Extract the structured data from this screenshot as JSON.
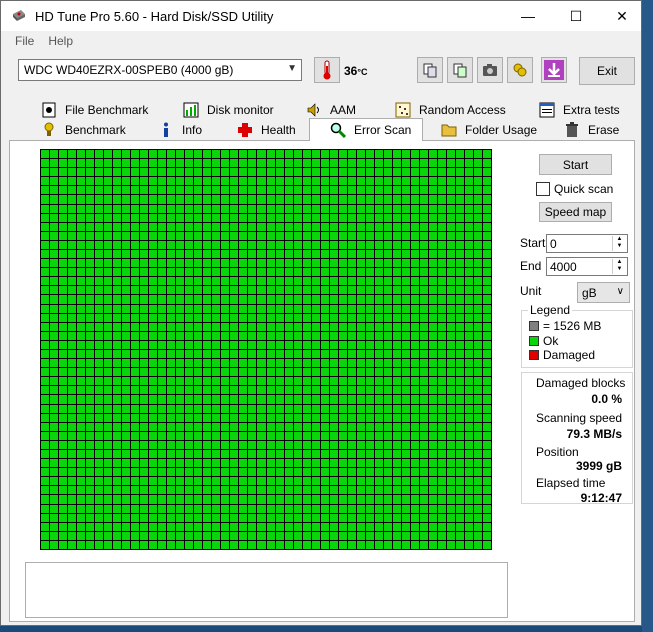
{
  "window": {
    "title": "HD Tune Pro 5.60 - Hard Disk/SSD Utility",
    "controls": {
      "minimize": "—",
      "maximize": "☐",
      "close": "✕"
    }
  },
  "menu": {
    "file": "File",
    "help": "Help"
  },
  "toolbar": {
    "drive": "WDC WD40EZRX-00SPEB0 (4000 gB)",
    "temperature": "36",
    "temperature_unit": "°C",
    "exit_label": "Exit"
  },
  "tabs_top": [
    {
      "label": "File Benchmark",
      "icon": "file-benchmark-icon"
    },
    {
      "label": "Disk monitor",
      "icon": "disk-monitor-icon"
    },
    {
      "label": "AAM",
      "icon": "speaker-icon"
    },
    {
      "label": "Random Access",
      "icon": "random-access-icon"
    },
    {
      "label": "Extra tests",
      "icon": "extra-tests-icon"
    }
  ],
  "tabs_bottom": [
    {
      "label": "Benchmark",
      "icon": "benchmark-icon"
    },
    {
      "label": "Info",
      "icon": "info-icon"
    },
    {
      "label": "Health",
      "icon": "health-cross-icon"
    },
    {
      "label": "Error Scan",
      "icon": "magnifier-icon",
      "active": true
    },
    {
      "label": "Folder Usage",
      "icon": "folder-icon"
    },
    {
      "label": "Erase",
      "icon": "trash-icon"
    }
  ],
  "scan": {
    "grid_state": "all blocks ok",
    "ok_color": "#0ad40a",
    "damaged_color": "#e00000",
    "block_color": "#808080"
  },
  "controls": {
    "start_button": "Start",
    "quick_scan_label": "Quick scan",
    "quick_scan_checked": false,
    "speed_map_button": "Speed map",
    "start_label": "Start",
    "start_value": "0",
    "end_label": "End",
    "end_value": "4000",
    "unit_label": "Unit",
    "unit_value": "gB"
  },
  "legend": {
    "title": "Legend",
    "block_size": "= 1526 MB",
    "ok": "Ok",
    "damaged": "Damaged"
  },
  "stats": {
    "damaged_blocks_label": "Damaged blocks",
    "damaged_blocks_value": "0.0 %",
    "scanning_speed_label": "Scanning speed",
    "scanning_speed_value": "79.3 MB/s",
    "position_label": "Position",
    "position_value": "3999 gB",
    "elapsed_label": "Elapsed time",
    "elapsed_value": "9:12:47"
  }
}
